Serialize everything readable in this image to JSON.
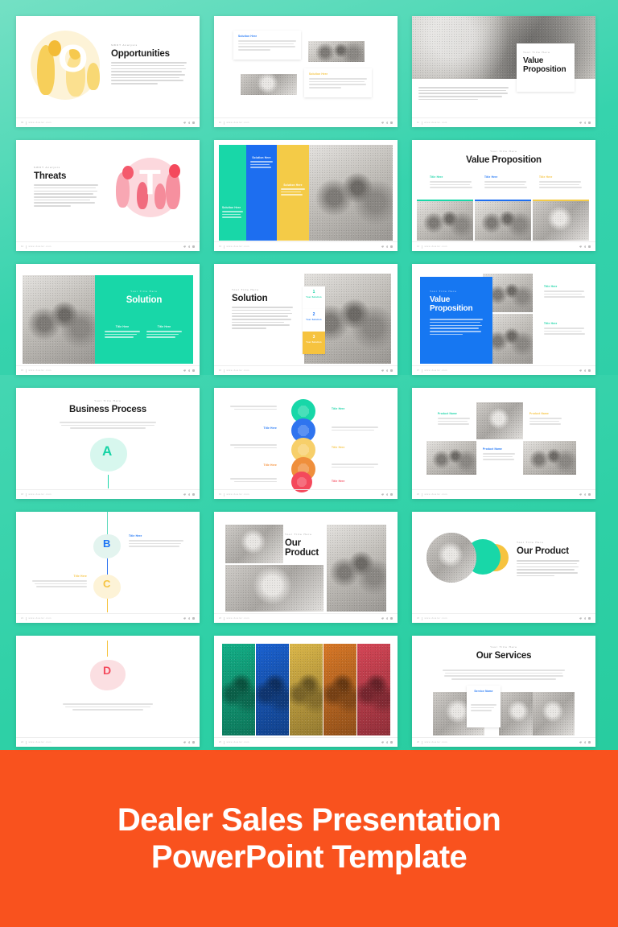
{
  "banner": {
    "line1": "Dealer Sales Presentation",
    "line2": "PowerPoint Template",
    "bg_color": "#f9521e",
    "text_color": "#ffffff"
  },
  "theme": {
    "background_top": "#36d3ad",
    "background_bottom": "#2ecc9f",
    "accent_teal": "#15d3a5",
    "accent_blue": "#1d74f5",
    "accent_yellow": "#f6c33f",
    "accent_orange": "#f58a2e",
    "accent_red": "#f4495c",
    "slide_bg": "#ffffff"
  },
  "footer": {
    "url": "www.dealer.com",
    "social": [
      "twitter-icon",
      "facebook-icon",
      "instagram-icon"
    ]
  },
  "slides": [
    {
      "id": "opportunities",
      "page": "09",
      "eyebrow": "SWOT Analysis",
      "title": "Opportunities",
      "body": "Trusted as the operating system of 40,000 merchants across 200 cities in Indonesia, Moka provides businesses of every size with powerful tools to run and grow, with an end-to-end solution that consists of POS, payments, loyalty, accounting, ingredient procurement, and business loans. On the back-end, Moka creates sales and gross profit reports across multiple outlets, tracks inventory.",
      "letter": "O",
      "letter_color": "#ffffff",
      "art_color": "#f6c33f"
    },
    {
      "id": "two-by-two-cards",
      "page": "10",
      "cards": [
        {
          "label": "Solution Here",
          "label_color": "#1d74f5",
          "body": "Lorem ipsum dolor sit amet, consectetuer adipiscing elit. Maecenas porttitor congue massa. Fusce posuere, magna sed pulvinar ultricies, purus lectus malesuada libero sit."
        },
        {
          "label": "Solution Here",
          "label_color": "#f6c33f",
          "body": "Lorem ipsum dolor sit amet, consectetuer adipiscing elit. Maecenas porttitor congue massa. Fusce posuere, magna sed pulvinar ultricies, purus lectus malesuada libero sit."
        }
      ],
      "photos": [
        "team-meeting-photo",
        "workshop-photo"
      ]
    },
    {
      "id": "value-proposition-hero",
      "page": "11",
      "eyebrow": "Your Title Here",
      "title": "Value Proposition",
      "body": "Trusted as the operating system of 40,000 merchants across 200 cities in Indonesia, Moka provides businesses of every size with powerful tools to run and grow, with an end-to-end solution that consists of POS, payments, loyalty, accounting, ingredient procurement, and business loans.",
      "photo": "woman-on-couch-photo"
    },
    {
      "id": "threats",
      "page": "12",
      "eyebrow": "SWOT Analysis",
      "title": "Threats",
      "body": "Trusted as the operating system of 40,000 merchants across 200 cities in Indonesia, Moka provides businesses of every size with powerful tools to run and grow, with an end-to-end solution that consists of POS, payments, loyalty, accounting, ingredient procurement and business loans. On the back-end, Moka creates sales and gross profit reports across multiple outlets, tracks inventory.",
      "letter": "T",
      "art_color": "#f4495c"
    },
    {
      "id": "solution-color-columns",
      "page": "13",
      "columns": [
        {
          "label": "Solution Here",
          "color": "#18d7a8",
          "body": "Lorem ipsum dolor sit amet, consectetuer adipiscing elit."
        },
        {
          "label": "Solution Here",
          "color": "#1d6ef0",
          "body": "Lorem ipsum dolor sit amet, consectetuer adipiscing elit."
        },
        {
          "label": "Solution Here",
          "color": "#f4cb47",
          "body": "Lorem ipsum dolor sit amet, consectetuer adipiscing elit."
        }
      ],
      "photo": "celebrating-people-photo"
    },
    {
      "id": "value-proposition-three-col",
      "page": "14",
      "eyebrow": "Your Title Here",
      "title": "Value Proposition",
      "columns": [
        {
          "label": "Title Here",
          "color": "#15d3a5",
          "body": "Lorem ipsum dolor sit amet, consectetuer adipiscing elit. Maecenas porttitor congue."
        },
        {
          "label": "Title Here",
          "color": "#1d74f5",
          "body": "Lorem ipsum dolor sit amet, consectetuer adipiscing elit. Maecenas porttitor congue."
        },
        {
          "label": "Title Here",
          "color": "#f6c33f",
          "body": "Lorem ipsum dolor sit amet, consectetuer adipiscing elit. Maecenas porttitor congue."
        }
      ],
      "photos": [
        "meeting-room-photo",
        "discussion-photo",
        "office-desk-photo"
      ]
    },
    {
      "id": "solution-teal-panel",
      "page": "15",
      "eyebrow": "Your Title Here",
      "title": "Solution",
      "panel_color": "#18d7a8",
      "columns": [
        {
          "label": "Title Here",
          "body": "Lorem ipsum dolor sit amet, consectetuer adipiscing elit. Maecenas porttitor congue."
        },
        {
          "label": "Title Here",
          "body": "Lorem ipsum dolor sit amet, consectetuer adipiscing elit. Maecenas porttitor congue."
        }
      ],
      "photo": "woman-with-laptop-photo"
    },
    {
      "id": "solution-numbered-steps",
      "page": "16",
      "eyebrow": "Your Title Here",
      "title": "Solution",
      "body": "Trusted as the operating system of 40,000 merchants across 200 cities in Indonesia, Moka provides businesses of every size with powerful tools to run and grow, with an end-to-end solution that consists of POS, payments, loyalty, accounting, ingredient procurement and business loans. On the back-end, Moka creates sales and gross profit reports across multiple outlets, tracks inventory.",
      "steps": [
        {
          "number": "1",
          "label": "Your Solution",
          "color": "#15d3a5",
          "filled": false
        },
        {
          "number": "2",
          "label": "Your Solution",
          "color": "#1d74f5",
          "filled": false
        },
        {
          "number": "3",
          "label": "Your Solution",
          "color": "#f6c33f",
          "filled": true
        }
      ],
      "photo": "business-meeting-photo"
    },
    {
      "id": "value-proposition-blue-block",
      "page": "17",
      "eyebrow": "Your Title Here",
      "title": "Value Proposition",
      "panel_color": "#1677f2",
      "body": "Trusted as the operating system of 40,000 merchants across 200 cities in Indonesia, Moka provides businesses of every size with powerful tools to run and grow, with an end-to-end solution that consists of POS, payments, loyalty, accounting, ingredient procurement and business loans.",
      "side_items": [
        {
          "label": "Title Here",
          "color": "#15d3a5",
          "body": "Lorem ipsum dolor sit amet, consectetuer adipiscing elit. Maecenas porttitor congue."
        },
        {
          "label": "Title Here",
          "color": "#15d3a5",
          "body": "Lorem ipsum dolor sit amet, consectetuer adipiscing elit. Maecenas porttitor congue."
        }
      ],
      "photos": [
        "standing-woman-photo",
        "two-men-photo",
        "team-photo"
      ]
    },
    {
      "id": "business-process-a",
      "page": "18",
      "eyebrow": "Your Title Here",
      "title": "Business Process",
      "body": "Trusted as the operating system of 40,000 merchants across 200 cities in Indonesia, Moka provides businesses of every size with powerful tools to run and grow, with an end-to-end solution that consists of POS, payments, loyalty, accounting, ingredient procurement.",
      "letter": "A",
      "letter_color": "#15d3a5",
      "blob_color": "#d7f7ee"
    },
    {
      "id": "process-five-circles",
      "page": "19",
      "steps": [
        {
          "label": "Title Here",
          "color": "#15d3a5",
          "side": "right",
          "body": "Lorem ipsum dolor sit amet, consectetuer adipiscing elit. Maecenas porttitor congue."
        },
        {
          "label": "Title Here",
          "color": "#1d74f5",
          "side": "left",
          "body": "Lorem ipsum dolor sit amet, consectetuer adipiscing elit. Maecenas porttitor congue."
        },
        {
          "label": "Title Here",
          "color": "#f6c33f",
          "side": "right",
          "body": "Lorem ipsum dolor sit amet, consectetuer adipiscing elit. Maecenas porttitor congue."
        },
        {
          "label": "Title Here",
          "color": "#f58a2e",
          "side": "left",
          "body": "Lorem ipsum dolor sit amet, consectetuer adipiscing elit. Maecenas porttitor congue."
        },
        {
          "label": "Title Here",
          "color": "#f4495c",
          "side": "right",
          "body": "Lorem ipsum dolor sit amet, consectetuer adipiscing elit. Maecenas porttitor congue."
        }
      ]
    },
    {
      "id": "product-grid",
      "page": "20",
      "items": [
        {
          "label": "Product Name",
          "color": "#15d3a5",
          "body": "Lorem ipsum dolor sit amet, consectetuer adipiscing elit. Maecenas porttitor congue."
        },
        {
          "label": "Product Name",
          "color": "#f6c33f",
          "body": "Lorem ipsum dolor sit amet, consectetuer adipiscing elit. Maecenas porttitor congue."
        },
        {
          "label": "Product Name",
          "color": "#1d74f5",
          "body": "Lorem ipsum dolor sit amet, consectetuer adipiscing elit. Maecenas porttitor congue."
        }
      ],
      "photos": [
        "desk-setup-photo",
        "man-with-laptop-photo",
        "man-at-desk-photo"
      ]
    },
    {
      "id": "business-process-bc",
      "page": "21",
      "nodes": [
        {
          "letter": "B",
          "letter_color": "#1d74f5",
          "blob_color": "#e3f4ef",
          "label": "Title Here",
          "side": "right",
          "body": "Lorem ipsum dolor sit amet, consectetuer adipiscing elit. Maecenas porttitor congue massa. Fusce posuere, magna sed pulvinar ultricies, purus lectus malesuada libero sit."
        },
        {
          "letter": "C",
          "letter_color": "#f6c33f",
          "blob_color": "#fdf3d7",
          "label": "Title Here",
          "side": "left",
          "body": "Lorem ipsum dolor sit amet, consectetuer adipiscing elit. Maecenas porttitor congue massa. Fusce posuere, magna sed pulvinar ultricies, purus lectus malesuada libero sit."
        }
      ]
    },
    {
      "id": "our-product-collage",
      "page": "22",
      "eyebrow": "Your Title Here",
      "title": "Our Product",
      "photos": [
        "hands-laptop-photo",
        "hands-typing-photo",
        "man-on-sofa-photo"
      ]
    },
    {
      "id": "our-product-circle",
      "page": "23",
      "eyebrow": "Your Title Here",
      "title": "Our Product",
      "body": "Trusted as the operating system of 40,000 merchants across 200 cities in Indonesia, Moka provides businesses of every size with powerful tools to run and grow, with an end-to-end solution that consists of POS, payments, loyalty, accounting, ingredient procurement and business loans. On the back-end, Moka creates sales and gross profit reports across multiple outlets, tracks inventory.",
      "circle_colors": [
        "#18d7a8",
        "#f6c33f"
      ],
      "photo": "laptop-stand-photo"
    },
    {
      "id": "business-process-d",
      "page": "24",
      "letter": "D",
      "letter_color": "#f4495c",
      "blob_color": "#fbdfe2",
      "body": "Lorem ipsum dolor sit amet, consectetuer adipiscing elit. Maecenas porttitor congue massa. Fusce posuere, magna sed pulvinar ultricies, purus lectus malesuada libero sit."
    },
    {
      "id": "five-color-portraits",
      "page": "25",
      "tints": [
        "#15c79c",
        "#1d6ef0",
        "#f6cf54",
        "#f1872c",
        "#ef4f63"
      ],
      "photos": [
        "portrait-1-photo",
        "portrait-2-photo",
        "portrait-3-photo",
        "portrait-4-photo",
        "portrait-5-photo"
      ]
    },
    {
      "id": "our-services",
      "page": "26",
      "eyebrow": "Your Title Here",
      "title": "Our Services",
      "body": "Trusted as the operating system of 40,000 merchants across 200 cities in Indonesia, Moka provides businesses of every size with powerful tools to run and grow, with an end-to-end solution that consists of POS, payments, loyalty, accounting, ingredient procurement, and business loans. On the back-end, Moka creates sales and gross profit reports across multiple outlets, tracks inventory.",
      "card": {
        "label": "Service Name",
        "label_color": "#1d74f5",
        "body": "Lorem ipsum dolor sit amet, consectetuer adipiscing elit. Maecenas porttitor congue."
      },
      "photos": [
        "laptop-desk-photo",
        "two-laptops-photo",
        "macbook-photo"
      ]
    }
  ]
}
